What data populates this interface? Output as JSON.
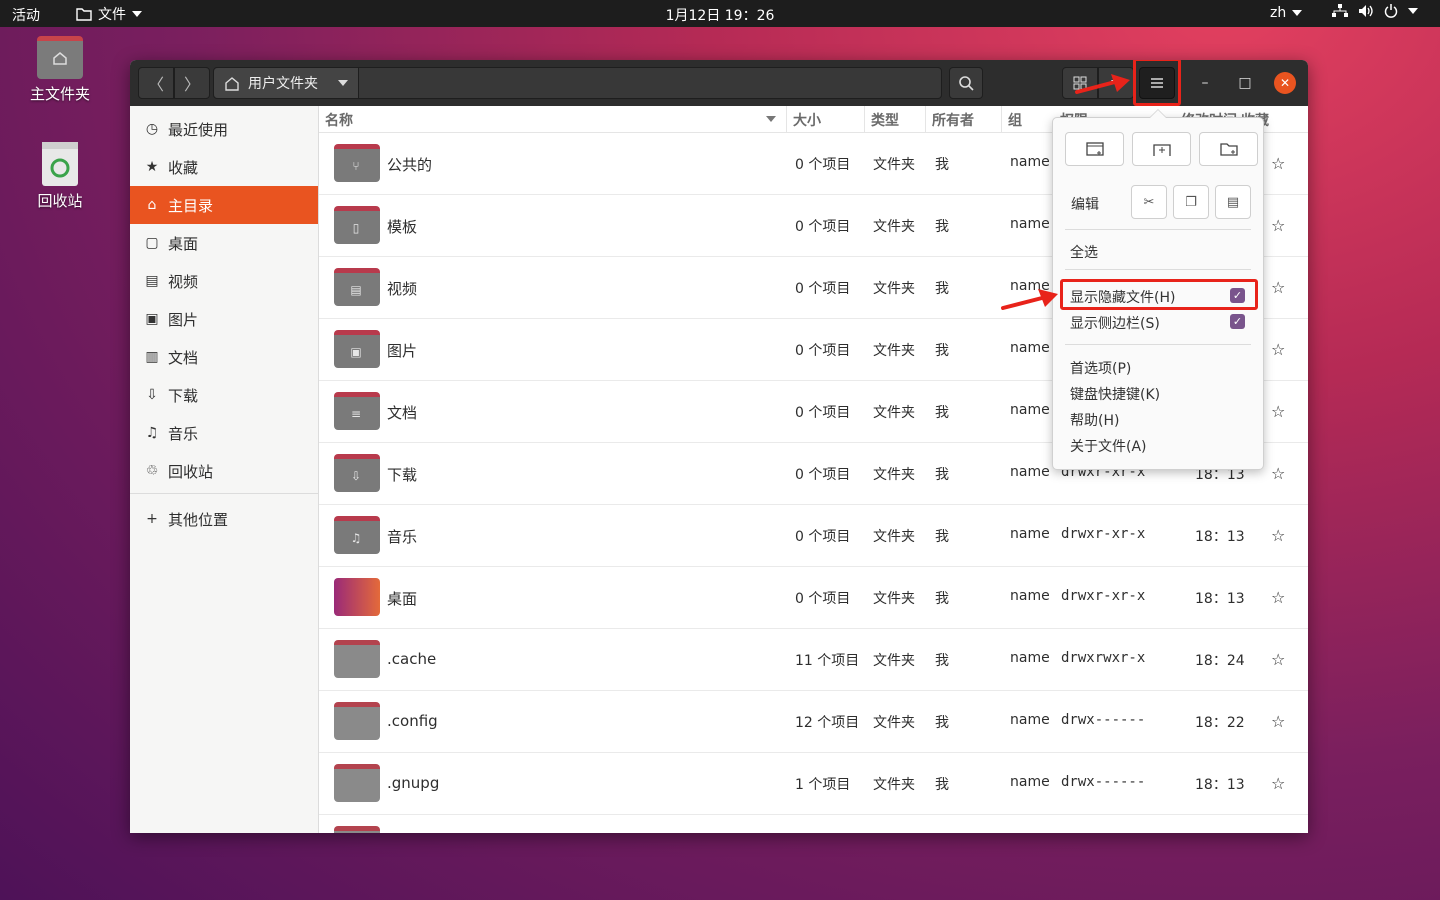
{
  "topbar": {
    "activities": "活动",
    "app_menu": "文件",
    "clock": "1月12日 19：26",
    "lang": "zh"
  },
  "desktop": {
    "home_label": "主文件夹",
    "trash_label": "回收站"
  },
  "window": {
    "path_label": "用户文件夹"
  },
  "sidebar": {
    "items": [
      {
        "label": "最近使用",
        "icon": "clock-icon"
      },
      {
        "label": "收藏",
        "icon": "star-icon"
      },
      {
        "label": "主目录",
        "icon": "home-icon",
        "active": true
      },
      {
        "label": "桌面",
        "icon": "desktop-icon"
      },
      {
        "label": "视频",
        "icon": "video-icon"
      },
      {
        "label": "图片",
        "icon": "image-icon"
      },
      {
        "label": "文档",
        "icon": "document-icon"
      },
      {
        "label": "下载",
        "icon": "download-icon"
      },
      {
        "label": "音乐",
        "icon": "music-icon"
      },
      {
        "label": "回收站",
        "icon": "trash-icon"
      }
    ],
    "other": "其他位置"
  },
  "list": {
    "headers": {
      "name": "名称",
      "size": "大小",
      "type": "类型",
      "owner": "所有者",
      "group": "组",
      "perm": "权限",
      "time": "修改时间",
      "star": "收藏"
    },
    "rows": [
      {
        "name": "公共的",
        "size": "0 个项目",
        "type": "文件夹",
        "owner": "我",
        "group": "name",
        "perm": "drwxr-xr-x",
        "time": "18：13",
        "icon": "share-icon"
      },
      {
        "name": "模板",
        "size": "0 个项目",
        "type": "文件夹",
        "owner": "我",
        "group": "name",
        "perm": "drwxr-xr-x",
        "time": "18：13",
        "icon": "template-icon"
      },
      {
        "name": "视频",
        "size": "0 个项目",
        "type": "文件夹",
        "owner": "我",
        "group": "name",
        "perm": "drwxr-xr-x",
        "time": "18：13",
        "icon": "video-icon"
      },
      {
        "name": "图片",
        "size": "0 个项目",
        "type": "文件夹",
        "owner": "我",
        "group": "name",
        "perm": "drwxr-xr-x",
        "time": "18：13",
        "icon": "image-icon"
      },
      {
        "name": "文档",
        "size": "0 个项目",
        "type": "文件夹",
        "owner": "我",
        "group": "name",
        "perm": "drwxr-xr-x",
        "time": "18：13",
        "icon": "document-icon"
      },
      {
        "name": "下载",
        "size": "0 个项目",
        "type": "文件夹",
        "owner": "我",
        "group": "name",
        "perm": "drwxr-xr-x",
        "time": "18：13",
        "icon": "download-icon"
      },
      {
        "name": "音乐",
        "size": "0 个项目",
        "type": "文件夹",
        "owner": "我",
        "group": "name",
        "perm": "drwxr-xr-x",
        "time": "18：13",
        "icon": "music-icon"
      },
      {
        "name": "桌面",
        "size": "0 个项目",
        "type": "文件夹",
        "owner": "我",
        "group": "name",
        "perm": "drwxr-xr-x",
        "time": "18：13",
        "icon": "desktop-icon"
      },
      {
        "name": ".cache",
        "size": "11 个项目",
        "type": "文件夹",
        "owner": "我",
        "group": "name",
        "perm": "drwxrwxr-x",
        "time": "18：24",
        "icon": "folder-icon"
      },
      {
        "name": ".config",
        "size": "12 个项目",
        "type": "文件夹",
        "owner": "我",
        "group": "name",
        "perm": "drwx------",
        "time": "18：22",
        "icon": "folder-icon"
      },
      {
        "name": ".gnupg",
        "size": "1 个项目",
        "type": "文件夹",
        "owner": "我",
        "group": "name",
        "perm": "drwx------",
        "time": "18：13",
        "icon": "folder-icon"
      }
    ]
  },
  "popover": {
    "edit_label": "编辑",
    "select_all": "全选",
    "show_hidden": "显示隐藏文件(H)",
    "show_sidebar": "显示侧边栏(S)",
    "preferences": "首选项(P)",
    "shortcuts": "键盘快捷键(K)",
    "help": "帮助(H)",
    "about": "关于文件(A)"
  },
  "colors": {
    "accent": "#e95420",
    "check": "#79548c",
    "annotation_red": "#e8231a"
  }
}
